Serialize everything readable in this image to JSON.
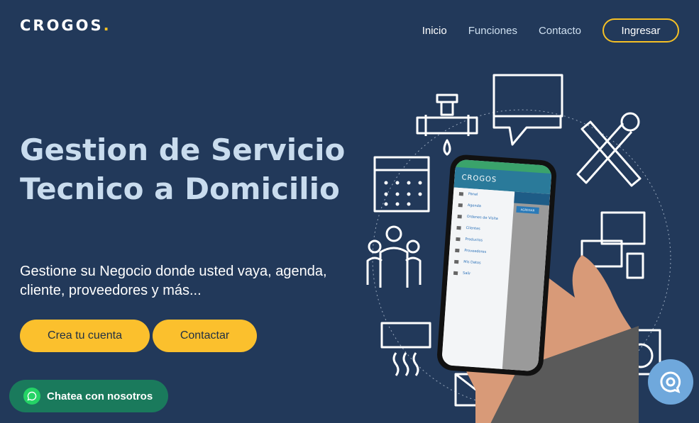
{
  "brand": {
    "name": "CROGOS",
    "dot": ".",
    "accent": "#f5c025"
  },
  "nav": {
    "items": [
      {
        "label": "Inicio",
        "active": true
      },
      {
        "label": "Funciones",
        "active": false
      },
      {
        "label": "Contacto",
        "active": false
      }
    ],
    "login_label": "Ingresar"
  },
  "hero": {
    "title": "Gestion de Servicio Tecnico a Domicilio",
    "subtitle": "Gestione su Negocio donde usted vaya, agenda, cliente, proveedores y más...",
    "cta_primary": "Crea tu cuenta",
    "cta_secondary": "Contactar"
  },
  "whatsapp": {
    "label": "Chatea con nosotros",
    "color": "#1a7a5c"
  },
  "phone_app": {
    "logo": "CROGOS",
    "menu": [
      "Panel",
      "Agenda",
      "Ordenes de Visita",
      "Clientes",
      "Productos",
      "Proveedores",
      "Mis Datos",
      "Salir"
    ],
    "button": "AGREGAR"
  },
  "icons": [
    "faucet-icon",
    "chat-bubbles-icon",
    "tools-icon",
    "calendar-icon",
    "users-icon",
    "devices-icon",
    "air-conditioner-icon",
    "washing-machine-icon",
    "mail-icon"
  ],
  "colors": {
    "background": "#22395a",
    "cta": "#fbc02d",
    "title": "#c9dcee"
  }
}
